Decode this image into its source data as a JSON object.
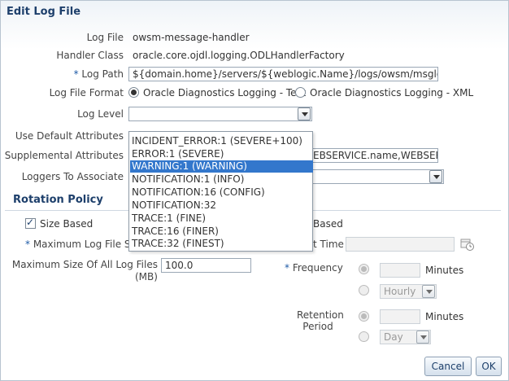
{
  "dialog": {
    "title": "Edit Log File"
  },
  "form": {
    "log_file_label": "Log File",
    "log_file_value": "owsm-message-handler",
    "handler_class_label": "Handler Class",
    "handler_class_value": "oracle.core.ojdl.logging.ODLHandlerFactory",
    "required_mark": "*",
    "log_path_label": "Log Path",
    "log_path_value": "${domain.home}/servers/${weblogic.Name}/logs/owsm/msglogging/",
    "log_file_format_label": "Log File Format",
    "format_option_text": "Oracle Diagnostics Logging - Text",
    "format_option_xml": "Oracle Diagnostics Logging - XML",
    "log_level_label": "Log Level",
    "use_default_attributes_label": "Use Default Attributes",
    "supplemental_attributes_label": "Supplemental Attributes",
    "supplemental_attributes_visible": "EBSERVICE.name,WEBSERV",
    "loggers_to_associate_label": "Loggers To Associate"
  },
  "log_level_dropdown": {
    "options": [
      "INCIDENT_ERROR:1 (SEVERE+100)",
      "ERROR:1 (SEVERE)",
      "WARNING:1 (WARNING)",
      "NOTIFICATION:1 (INFO)",
      "NOTIFICATION:16 (CONFIG)",
      "NOTIFICATION:32",
      "TRACE:1 (FINE)",
      "TRACE:16 (FINER)",
      "TRACE:32 (FINEST)"
    ],
    "selected": "WARNING:1 (WARNING)"
  },
  "rotation": {
    "section_title": "Rotation Policy",
    "size_based_label": "Size Based",
    "size_based_checked": true,
    "time_based_label_visible": "Based",
    "max_log_file_size_label_visible": "Maximum Log File Siz",
    "start_time_label_visible": "t Time",
    "max_size_all_label": "Maximum Size Of All Log Files",
    "max_size_all_unit": "(MB)",
    "max_size_all_value": "100.0",
    "frequency_label": "Frequency",
    "minutes_label": "Minutes",
    "hourly_option": "Hourly",
    "retention_period_label_1": "Retention",
    "retention_period_label_2": "Period",
    "retention_minutes_label": "Minutes",
    "day_option": "Day"
  },
  "buttons": {
    "cancel": "Cancel",
    "ok": "OK"
  },
  "colors": {
    "title": "#1d3f6b",
    "selection": "#3377cc",
    "required": "#1d5aa6"
  }
}
